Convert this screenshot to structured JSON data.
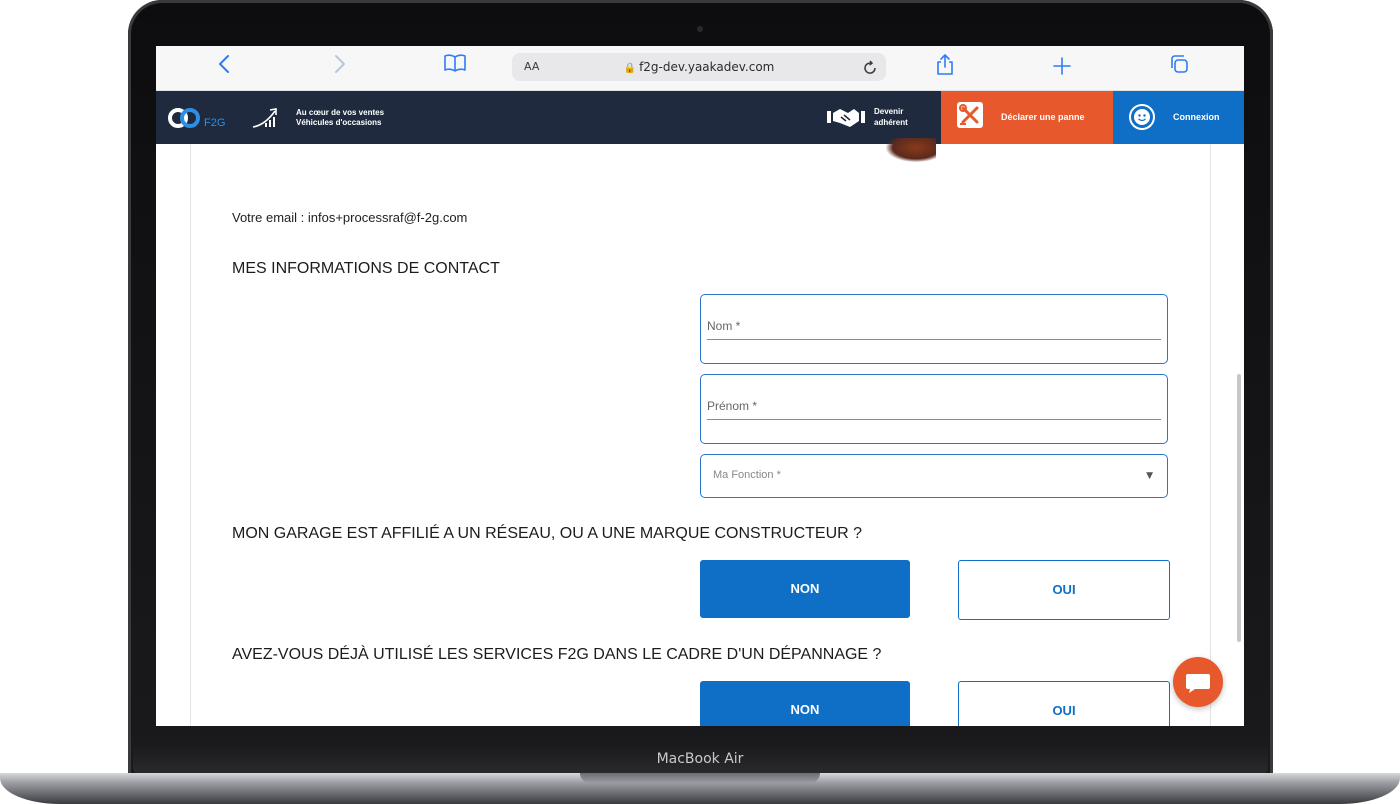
{
  "device": {
    "model_label": "MacBook Air"
  },
  "browser": {
    "url": "f2g-dev.yaakadev.com",
    "text_size_label": "AA",
    "icons": {
      "back": "chevron-left-icon",
      "forward": "chevron-right-icon",
      "bookmarks": "book-icon",
      "reload": "reload-icon",
      "share": "share-icon",
      "new_tab": "plus-icon",
      "tabs": "tabs-icon"
    },
    "accent_color": "#2f7cf6"
  },
  "header": {
    "tagline_line1": "Au cœur de vos ventes",
    "tagline_line2": "Véhicules d'occasions",
    "devenir_line1": "Devenir",
    "devenir_line2": "adhérent",
    "declarer_label": "Déclarer une panne",
    "connexion_label": "Connexion",
    "colors": {
      "background": "#1f2a3f",
      "orange": "#e8582d",
      "blue": "#0f6fc6"
    }
  },
  "form": {
    "email_line": "Votre email : infos+processraf@f-2g.com",
    "contact_title": "MES INFORMATIONS DE CONTACT",
    "fields": {
      "nom_label": "Nom *",
      "prenom_label": "Prénom *",
      "fonction_placeholder": "Ma Fonction *"
    },
    "question1": "MON GARAGE EST AFFILIÉ A UN RÉSEAU, OU A UNE MARQUE CONSTRUCTEUR ?",
    "question1_no": "NON",
    "question1_yes": "OUI",
    "question2": "AVEZ-VOUS DÉJÀ UTILISÉ LES SERVICES F2G DANS LE CADRE D'UN DÉPANNAGE ?",
    "question2_no": "NON",
    "question2_yes": "OUI"
  }
}
